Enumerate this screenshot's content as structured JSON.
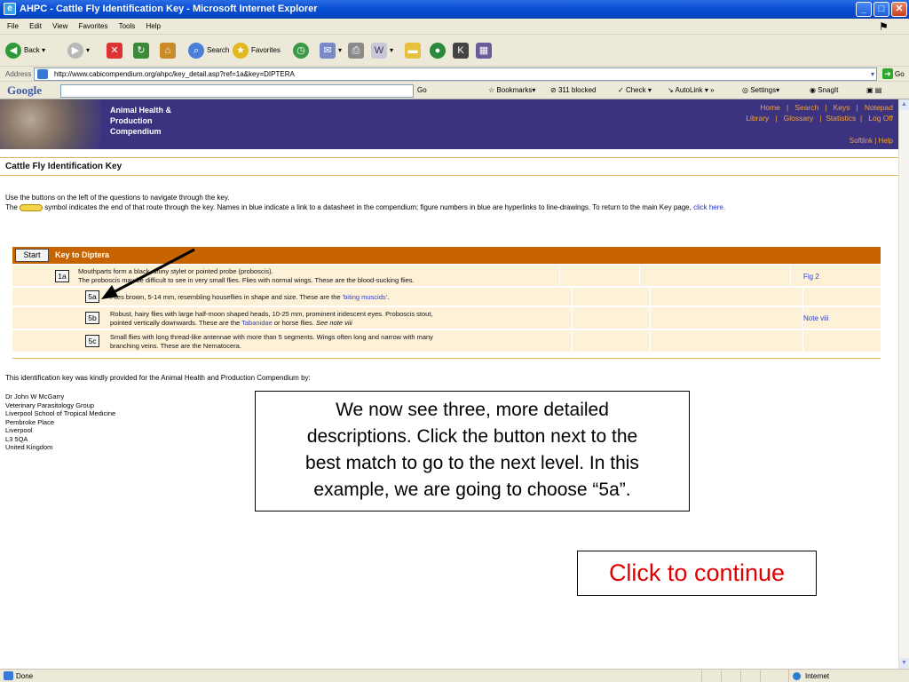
{
  "window": {
    "title": "AHPC - Cattle Fly Identification Key - Microsoft Internet Explorer"
  },
  "menu": [
    "File",
    "Edit",
    "View",
    "Favorites",
    "Tools",
    "Help"
  ],
  "toolbar": {
    "back": "Back",
    "search": "Search",
    "favorites": "Favorites"
  },
  "address": {
    "label": "Address",
    "url": "http://www.cabicompendium.org/ahpc/key_detail.asp?ref=1a&key=DIPTERA",
    "go": "Go"
  },
  "googlebar": {
    "logo": "Google",
    "go": "Go",
    "bookmarks": "Bookmarks",
    "blocked": "311 blocked",
    "check": "Check",
    "autolink": "AutoLink",
    "settings": "Settings",
    "snagit": "SnagIt"
  },
  "page": {
    "site_title_1": "Animal Health &",
    "site_title_2": "Production",
    "site_title_3": "Compendium",
    "nav_row1": "Home   |   Search   |   Keys   |   Notepad",
    "nav_row2": "Library   |   Glossary   |  Statistics  |   Log Off",
    "softlink": "Softlink | Help",
    "heading": "Cattle Fly Identification Key",
    "intro_1": "Use the buttons on the left of the questions to navigate through the key.",
    "intro_2a": "The",
    "intro_2b": "symbol indicates the end of that route through the key. Names in blue indicate a link to a datasheet in the compendium; figure numbers in blue are hyperlinks to line-drawings. To return to the main Key page,",
    "intro_link": "click here.",
    "start": "Start",
    "key_label": "Key to Diptera",
    "rows": [
      {
        "btn": "1a",
        "text1": "Mouthparts form a black, shiny stylet or pointed probe (proboscis).",
        "text2": "The proboscis may be difficult to see in very small flies. Flies with normal wings. These are the blood-sucking flies.",
        "fig": "Fig 2"
      },
      {
        "btn": "5a",
        "text1": "Flies brown, 5-14 mm, resembling houseflies in shape and size. These are the ",
        "link": "'biting muscids'",
        "text2": ".",
        "fig": ""
      },
      {
        "btn": "5b",
        "text1": "Robust, hairy flies with large half-moon shaped heads, 10-25 mm, prominent iridescent eyes. Proboscis stout,",
        "text2a": "pointed vertically downwards. These are the ",
        "link": "Tabanidae",
        "text2b": " or horse flies. ",
        "note": "See note viii",
        "fig": "Note viii"
      },
      {
        "btn": "5c",
        "text1": "Small flies with long thread-like antennae with more than 5 segments. Wings often long and narrow with many",
        "text2": "branching veins. These are the Nematocera.",
        "fig": ""
      }
    ],
    "provided": "This identification key was kindly provided for the Animal Health and Production Compendium by:",
    "author": [
      "Dr John W McGarry",
      "Veterinary Parasitology Group",
      "Liverpool School of Tropical Medicine",
      "Pembroke Place",
      "Liverpool",
      "L3 5QA",
      "United Kingdom"
    ]
  },
  "callout": {
    "line1": "We now see three, more detailed",
    "line2": "descriptions.  Click the button next to the",
    "line3": "best match to go to the next level.  In this",
    "line4": "example, we are going to choose “5a”."
  },
  "continue_label": "Click to continue",
  "status": {
    "done": "Done",
    "zone": "Internet"
  }
}
